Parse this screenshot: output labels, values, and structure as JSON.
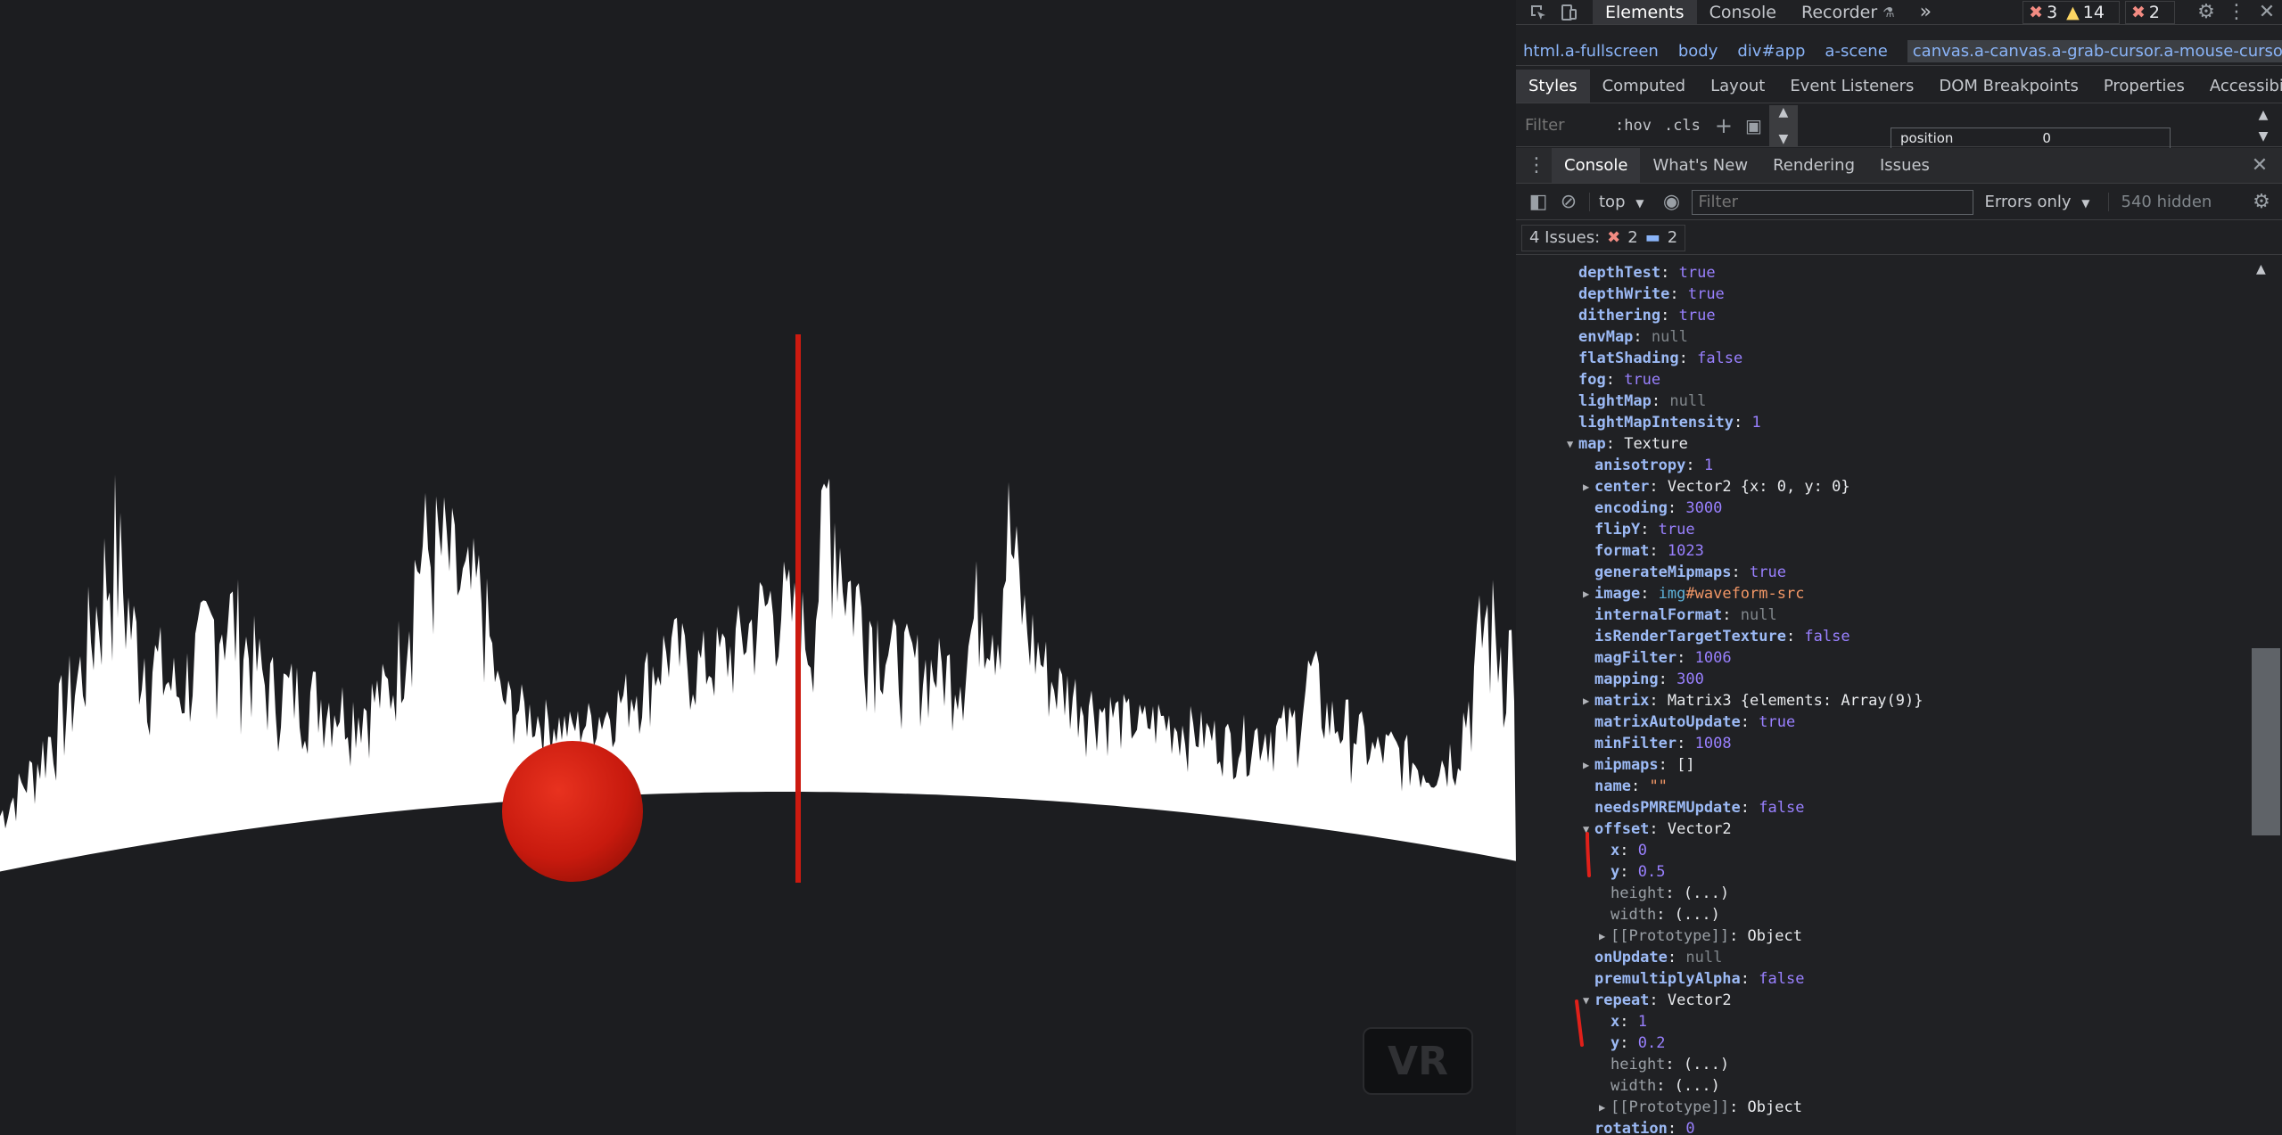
{
  "scene": {
    "vr_button": "VR",
    "sphere_color": "#d42010",
    "marker_color": "#cc1a10",
    "waveform_color": "#ffffff",
    "background_color": "#1c1d20"
  },
  "devtools": {
    "top_tabs": [
      "Elements",
      "Console",
      "Recorder"
    ],
    "active_top_tab": "Elements",
    "more_tabs_label": "»",
    "counts": {
      "errors": "3",
      "warnings": "14",
      "issues": "2"
    },
    "breadcrumbs": [
      "html.a-fullscreen",
      "body",
      "div#app",
      "a-scene",
      "canvas.a-canvas.a-grab-cursor.a-mouse-cursor-hover"
    ],
    "sub_tabs": [
      "Styles",
      "Computed",
      "Layout",
      "Event Listeners",
      "DOM Breakpoints",
      "Properties",
      "Accessibility"
    ],
    "styles_filter_placeholder": "Filter",
    "hov_label": ":hov",
    "cls_label": ".cls",
    "box_model": {
      "label": "position",
      "value": "0"
    },
    "drawer_tabs": [
      "Console",
      "What's New",
      "Rendering",
      "Issues"
    ],
    "console_toolbar": {
      "context": "top",
      "filter_placeholder": "Filter",
      "level": "Errors only",
      "hidden": "540 hidden"
    },
    "issues_bar": {
      "label": "4 Issues:",
      "errors": "2",
      "infos": "2"
    },
    "console_lines": [
      {
        "indent": 0,
        "key": "depthTest",
        "value": "true",
        "type": "bool"
      },
      {
        "indent": 0,
        "key": "depthWrite",
        "value": "true",
        "type": "bool"
      },
      {
        "indent": 0,
        "key": "dithering",
        "value": "true",
        "type": "bool"
      },
      {
        "indent": 0,
        "key": "envMap",
        "value": "null",
        "type": "null"
      },
      {
        "indent": 0,
        "key": "flatShading",
        "value": "false",
        "type": "bool"
      },
      {
        "indent": 0,
        "key": "fog",
        "value": "true",
        "type": "bool"
      },
      {
        "indent": 0,
        "key": "lightMap",
        "value": "null",
        "type": "null"
      },
      {
        "indent": 0,
        "key": "lightMapIntensity",
        "value": "1",
        "type": "num"
      },
      {
        "indent": 0,
        "key": "map",
        "value": "Texture",
        "type": "obj",
        "arrow": "open"
      },
      {
        "indent": 1,
        "key": "anisotropy",
        "value": "1",
        "type": "num"
      },
      {
        "indent": 1,
        "key": "center",
        "value": "Vector2 {x: 0, y: 0}",
        "type": "obj",
        "arrow": "closed"
      },
      {
        "indent": 1,
        "key": "encoding",
        "value": "3000",
        "type": "num"
      },
      {
        "indent": 1,
        "key": "flipY",
        "value": "true",
        "type": "bool"
      },
      {
        "indent": 1,
        "key": "format",
        "value": "1023",
        "type": "num"
      },
      {
        "indent": 1,
        "key": "generateMipmaps",
        "value": "true",
        "type": "bool"
      },
      {
        "indent": 1,
        "key": "image",
        "value": "img#waveform-src",
        "type": "elem",
        "arrow": "closed"
      },
      {
        "indent": 1,
        "key": "internalFormat",
        "value": "null",
        "type": "null"
      },
      {
        "indent": 1,
        "key": "isRenderTargetTexture",
        "value": "false",
        "type": "bool"
      },
      {
        "indent": 1,
        "key": "magFilter",
        "value": "1006",
        "type": "num"
      },
      {
        "indent": 1,
        "key": "mapping",
        "value": "300",
        "type": "num"
      },
      {
        "indent": 1,
        "key": "matrix",
        "value": "Matrix3 {elements: Array(9)}",
        "type": "obj",
        "arrow": "closed"
      },
      {
        "indent": 1,
        "key": "matrixAutoUpdate",
        "value": "true",
        "type": "bool"
      },
      {
        "indent": 1,
        "key": "minFilter",
        "value": "1008",
        "type": "num"
      },
      {
        "indent": 1,
        "key": "mipmaps",
        "value": "[]",
        "type": "obj",
        "arrow": "closed"
      },
      {
        "indent": 1,
        "key": "name",
        "value": "\"\"",
        "type": "str"
      },
      {
        "indent": 1,
        "key": "needsPMREMUpdate",
        "value": "false",
        "type": "bool"
      },
      {
        "indent": 1,
        "key": "offset",
        "value": "Vector2",
        "type": "obj",
        "arrow": "open"
      },
      {
        "indent": 2,
        "key": "x",
        "value": "0",
        "type": "num"
      },
      {
        "indent": 2,
        "key": "y",
        "value": "0.5",
        "type": "num"
      },
      {
        "indent": 2,
        "key": "height",
        "value": "(...)",
        "type": "obj",
        "dim": true
      },
      {
        "indent": 2,
        "key": "width",
        "value": "(...)",
        "type": "obj",
        "dim": true
      },
      {
        "indent": 2,
        "key": "[[Prototype]]",
        "value": "Object",
        "type": "obj",
        "arrow": "closed",
        "dim": true
      },
      {
        "indent": 1,
        "key": "onUpdate",
        "value": "null",
        "type": "null"
      },
      {
        "indent": 1,
        "key": "premultiplyAlpha",
        "value": "false",
        "type": "bool"
      },
      {
        "indent": 1,
        "key": "repeat",
        "value": "Vector2",
        "type": "obj",
        "arrow": "open"
      },
      {
        "indent": 2,
        "key": "x",
        "value": "1",
        "type": "num"
      },
      {
        "indent": 2,
        "key": "y",
        "value": "0.2",
        "type": "num"
      },
      {
        "indent": 2,
        "key": "height",
        "value": "(...)",
        "type": "obj",
        "dim": true
      },
      {
        "indent": 2,
        "key": "width",
        "value": "(...)",
        "type": "obj",
        "dim": true
      },
      {
        "indent": 2,
        "key": "[[Prototype]]",
        "value": "Object",
        "type": "obj",
        "arrow": "closed",
        "dim": true
      },
      {
        "indent": 1,
        "key": "rotation",
        "value": "0",
        "type": "num"
      }
    ]
  }
}
